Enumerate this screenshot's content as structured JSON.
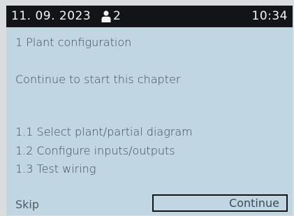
{
  "status_bar": {
    "date": "11. 09. 2023",
    "user_icon": "person-icon",
    "user_count": "2",
    "time": "10:34"
  },
  "chapter": {
    "title": "1 Plant configuration",
    "intro": "Continue to start this chapter",
    "items": [
      "1.1 Select plant/partial diagram",
      "1.2 Configure inputs/outputs",
      "1.3 Test wiring"
    ]
  },
  "footer": {
    "skip_label": "Skip",
    "continue_label": "Continue"
  },
  "colors": {
    "screen_background": "#c1d6e3",
    "status_bar_background": "#121417",
    "text": "#3e4a52"
  }
}
